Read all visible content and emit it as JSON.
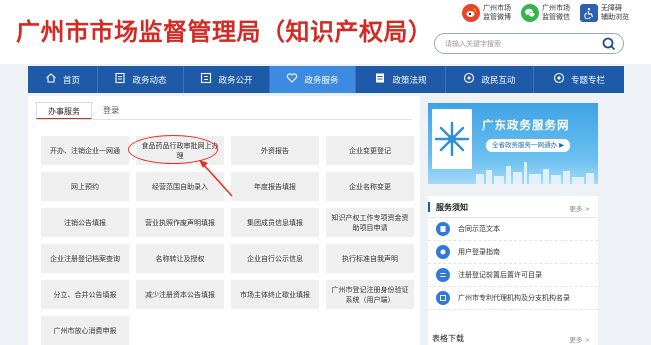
{
  "header": {
    "site_title": "广州市市场监督管理局（知识产权局）",
    "top_links": [
      {
        "label": "广州市场\n监管微博",
        "icon": "weibo-icon",
        "color": "#e8432b"
      },
      {
        "label": "广州市场\n监管微信",
        "icon": "wechat-icon",
        "color": "#36b34a"
      },
      {
        "label": "无障碍\n辅助浏览",
        "icon": "accessibility-icon",
        "color": "#2f5fb0"
      }
    ],
    "search_placeholder": "请输入关键字搜索"
  },
  "nav": {
    "items": [
      {
        "label": "首页",
        "icon": "home-icon"
      },
      {
        "label": "政务动态",
        "icon": "news-icon"
      },
      {
        "label": "政务公开",
        "icon": "open-icon"
      },
      {
        "label": "政务服务",
        "icon": "heart-icon"
      },
      {
        "label": "政策法规",
        "icon": "policy-icon"
      },
      {
        "label": "政民互动",
        "icon": "interact-icon"
      },
      {
        "label": "专题专栏",
        "icon": "column-icon"
      }
    ],
    "active_index": 3
  },
  "left": {
    "tabs": [
      "办事服务",
      "登录"
    ],
    "services": [
      "开办、注销企业一网通",
      "食品药品行政审批网上办理",
      "外资报告",
      "企业变更登记",
      "网上预约",
      "经营范围自助录入",
      "年度报告填报",
      "企业名称变更",
      "注销公告填报",
      "营业执照作废声明填报",
      "集团成员信息填报",
      "知识产权工作专项资金资助项目申请",
      "企业注册登记档案查询",
      "名称转让及授权",
      "企业自行公示信息",
      "执行标准自我声明",
      "分立、合并公告填报",
      "减少注册资本公告填报",
      "市场主体终止歇业填报",
      "广州市登记注册身份验证系统（用户端）",
      "广州市放心消费申报"
    ]
  },
  "right": {
    "banner_title": "广东政务服务网",
    "banner_sub": "全省政务服务一网通办 ▶",
    "service_guide": {
      "title": "服务须知",
      "more": "更多 >",
      "items": [
        "合同示范文本",
        "用户登录指南",
        "注册登记前置后置许可目录",
        "广州市专利代理机构及分支机构名录"
      ]
    },
    "downloads": {
      "title": "表格下载",
      "more": "更多 >"
    }
  },
  "colors": {
    "brand_red": "#d42a24",
    "nav_blue": "#1e5aa8",
    "nav_active": "#3d8be0"
  }
}
